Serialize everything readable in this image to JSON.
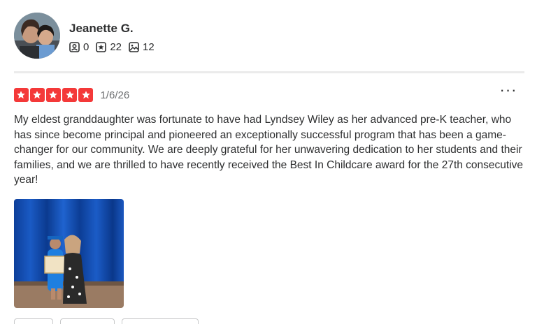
{
  "reviewer": {
    "name": "Jeanette G.",
    "stats": {
      "friends": "0",
      "reviews": "22",
      "photos": "12"
    }
  },
  "review": {
    "rating": 5,
    "date": "1/6/26",
    "text": "My eldest granddaughter was fortunate to have had Lyndsey Wiley as her advanced pre-K teacher, who has since become principal and pioneered an exceptionally successful program that has been a game-changer for our community. We are deeply grateful for her unwavering dedication to her students and their families, and we are thrilled to have recently received the Best In Childcare award for the 27th consecutive year!",
    "more_label": "···"
  },
  "colors": {
    "star": "#f43939",
    "text": "#2d2e2f",
    "muted": "#6e7072"
  },
  "icons": {
    "friends": "friends-icon",
    "reviews": "star-badge-icon",
    "photos": "photo-icon",
    "more": "more-options-icon"
  }
}
